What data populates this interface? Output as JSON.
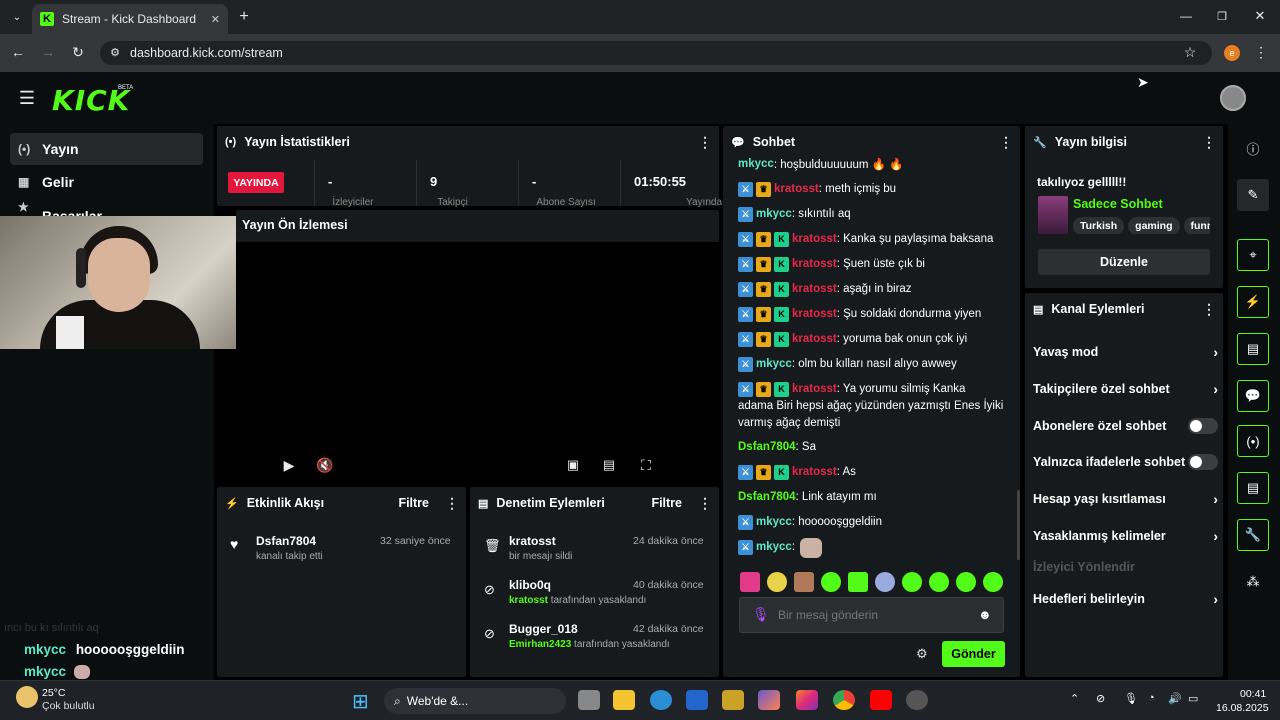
{
  "browser": {
    "tab_title": "Stream - Kick Dashboard",
    "url": "dashboard.kick.com/stream",
    "profile_initial": "e"
  },
  "header": {
    "logo": "KICK",
    "beta": "BETA"
  },
  "sidebar": {
    "items": [
      {
        "label": "Yayın"
      },
      {
        "label": "Gelir"
      },
      {
        "label": "Başarılar"
      }
    ]
  },
  "overlay_chat": {
    "faded": "ıncı bu kı sılıntılı aq",
    "lines": [
      {
        "user": "mkycc",
        "text": "hoooooşggeldiin"
      },
      {
        "user": "mkycc",
        "text": ""
      }
    ]
  },
  "stats": {
    "title": "Yayın İstatistikleri",
    "live_label": "YAYINDA",
    "items": [
      {
        "value": "-",
        "label": "İzleyiciler"
      },
      {
        "value": "9",
        "label": "Takipçi"
      },
      {
        "value": "-",
        "label": "Abone Sayısı"
      },
      {
        "value": "01:50:55",
        "label": "Yayında"
      }
    ]
  },
  "preview": {
    "title": "Yayın Ön İzlemesi"
  },
  "activity": {
    "title": "Etkinlik Akışı",
    "filter": "Filtre",
    "items": [
      {
        "name": "Dsfan7804",
        "sub": "kanalı takip etti",
        "time": "32 saniye önce"
      }
    ]
  },
  "moderation": {
    "title": "Denetim Eylemleri",
    "filter": "Filtre",
    "items": [
      {
        "name": "kratosst",
        "actor": "",
        "sub": "bir mesajı sildi",
        "time": "24 dakika önce"
      },
      {
        "name": "klibo0q",
        "actor": "kratosst",
        "sub": "tarafından yasaklandı",
        "time": "40 dakika önce"
      },
      {
        "name": "Bugger_018",
        "actor": "Emirhan2423",
        "sub": "tarafından yasaklandı",
        "time": "42 dakika önce"
      }
    ]
  },
  "chat": {
    "title": "Sohbet",
    "messages": [
      {
        "badges": 0,
        "user": "mkycc",
        "color": "teal",
        "text": ": hoşbulduuuuuum 🔥 🔥"
      },
      {
        "badges": 2,
        "user": "kratosst",
        "color": "red",
        "text": ": meth içmiş bu"
      },
      {
        "badges": 1,
        "user": "mkycc",
        "color": "teal",
        "text": ": sıkıntılı aq"
      },
      {
        "badges": 3,
        "user": "kratosst",
        "color": "red",
        "text": ": Kanka şu paylaşıma baksana"
      },
      {
        "badges": 3,
        "user": "kratosst",
        "color": "red",
        "text": ": Şuen üste çık bi"
      },
      {
        "badges": 3,
        "user": "kratosst",
        "color": "red",
        "text": ": aşağı in biraz"
      },
      {
        "badges": 3,
        "user": "kratosst",
        "color": "red",
        "text": ": Şu soldaki dondurma yiyen"
      },
      {
        "badges": 3,
        "user": "kratosst",
        "color": "red",
        "text": ": yoruma bak onun çok iyi"
      },
      {
        "badges": 1,
        "user": "mkycc",
        "color": "teal",
        "text": ": olm bu kılları nasıl alıyo awwey"
      }
    ],
    "long_msg": {
      "user": "kratosst",
      "line1": ": Ya yorumu silmiş Kanka",
      "line2": "adama Biri hepsi ağaç yüzünden yazmıştı Enes İyiki",
      "line3": "varmış ağaç demişti"
    },
    "messages2": [
      {
        "badges": 0,
        "user": "Dsfan7804",
        "color": "green",
        "text": ": Sa"
      },
      {
        "badges": 3,
        "user": "kratosst",
        "color": "red",
        "text": ": As"
      },
      {
        "badges": 0,
        "user": "Dsfan7804",
        "color": "green",
        "text": ": Link atayım mı"
      },
      {
        "badges": 1,
        "user": "mkycc",
        "color": "teal",
        "text": ": hoooooşggeldiin"
      },
      {
        "badges": 1,
        "user": "mkycc",
        "color": "teal",
        "text": ":"
      }
    ],
    "placeholder": "Bir mesaj gönderin",
    "send": "Gönder"
  },
  "stream_info": {
    "title": "Yayın bilgisi",
    "stream_title": "takılıyoz gelllll!!",
    "category": "Sadece Sohbet",
    "tags": [
      "Turkish",
      "gaming",
      "funny"
    ],
    "edit": "Düzenle"
  },
  "channel_actions": {
    "title": "Kanal Eylemleri",
    "rows": [
      {
        "label": "Yavaş mod",
        "type": "arrow"
      },
      {
        "label": "Takipçilere özel sohbet",
        "type": "arrow"
      },
      {
        "label": "Abonelere özel sohbet",
        "type": "toggle"
      },
      {
        "label": "Yalnızca ifadelerle sohbet",
        "type": "toggle"
      },
      {
        "label": "Hesap yaşı kısıtlaması",
        "type": "arrow"
      },
      {
        "label": "Yasaklanmış kelimeler",
        "type": "arrow"
      }
    ],
    "disabled": "İzleyici Yönlendir",
    "last": "Hedefleri belirleyin"
  },
  "taskbar": {
    "temp": "25°C",
    "weather": "Çok bulutlu",
    "search": "Web'de &...",
    "time": "00:41",
    "date": "16.08.2025"
  },
  "colors": {
    "accent": "#53fc18",
    "live": "#e3163e",
    "panel": "#171a1c"
  }
}
